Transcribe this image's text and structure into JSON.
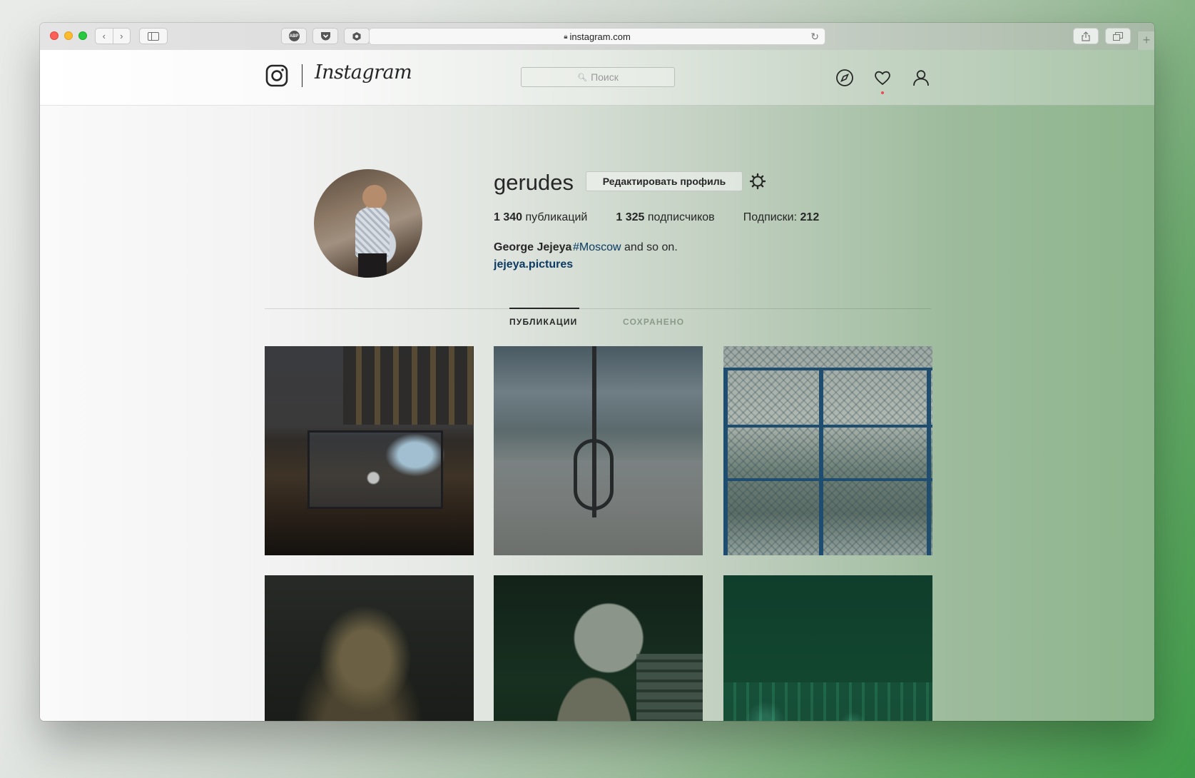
{
  "browser": {
    "url": "instagram.com",
    "tab_plus": "+"
  },
  "header": {
    "wordmark": "Instagram",
    "search_placeholder": "Поиск"
  },
  "profile": {
    "username": "gerudes",
    "edit_label": "Редактировать профиль",
    "stats": {
      "posts_count": "1 340",
      "posts_label": "публикаций",
      "followers_count": "1 325",
      "followers_label": "подписчиков",
      "following_label": "Подписки:",
      "following_count": "212"
    },
    "bio": {
      "name": "George Jejeya",
      "hashtag": "#Moscow",
      "rest": "and so on.",
      "link": "jejeya.pictures"
    }
  },
  "tabs": {
    "posts": "ПУБЛИКАЦИИ",
    "saved": "СОХРАНЕНО"
  },
  "colors": {
    "link": "#0b3b63",
    "notification_dot": "#ed4956",
    "close": "#fc5f57",
    "minimize": "#fdbc2e",
    "zoom": "#28c840"
  }
}
